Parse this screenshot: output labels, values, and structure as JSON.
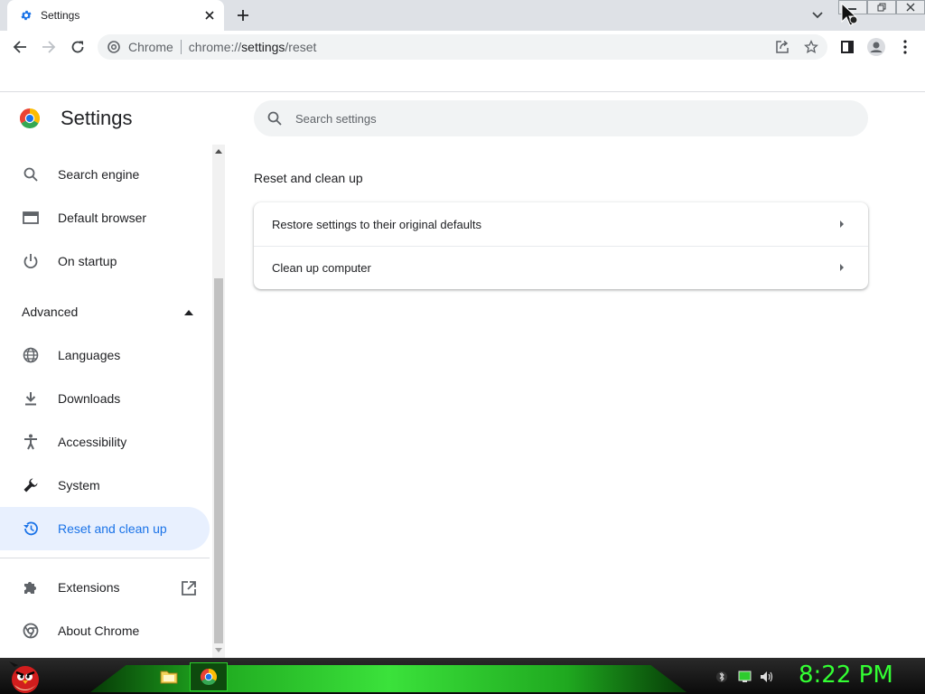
{
  "browser": {
    "tab_title": "Settings",
    "omnibox": {
      "site_label": "Chrome",
      "url_prefix": "chrome://",
      "url_path": "settings",
      "url_suffix": "/reset"
    }
  },
  "settings": {
    "page_title": "Settings",
    "search_placeholder": "Search settings",
    "sidebar": {
      "items": [
        {
          "label": "Search engine",
          "icon": "search-icon"
        },
        {
          "label": "Default browser",
          "icon": "browser-icon"
        },
        {
          "label": "On startup",
          "icon": "power-icon"
        }
      ],
      "advanced_label": "Advanced",
      "advanced_items": [
        {
          "label": "Languages",
          "icon": "globe-icon"
        },
        {
          "label": "Downloads",
          "icon": "download-icon"
        },
        {
          "label": "Accessibility",
          "icon": "accessibility-icon"
        },
        {
          "label": "System",
          "icon": "wrench-icon"
        },
        {
          "label": "Reset and clean up",
          "icon": "history-icon",
          "active": true
        }
      ],
      "footer_items": [
        {
          "label": "Extensions",
          "icon": "puzzle-icon"
        },
        {
          "label": "About Chrome",
          "icon": "chrome-icon"
        }
      ]
    },
    "section": {
      "title": "Reset and clean up",
      "rows": [
        {
          "label": "Restore settings to their original defaults"
        },
        {
          "label": "Clean up computer"
        }
      ]
    }
  },
  "taskbar": {
    "clock": "8:22 PM"
  },
  "colors": {
    "accent": "#1a73e8",
    "active_bg": "#e8f0fe",
    "clock": "#33ff33"
  }
}
